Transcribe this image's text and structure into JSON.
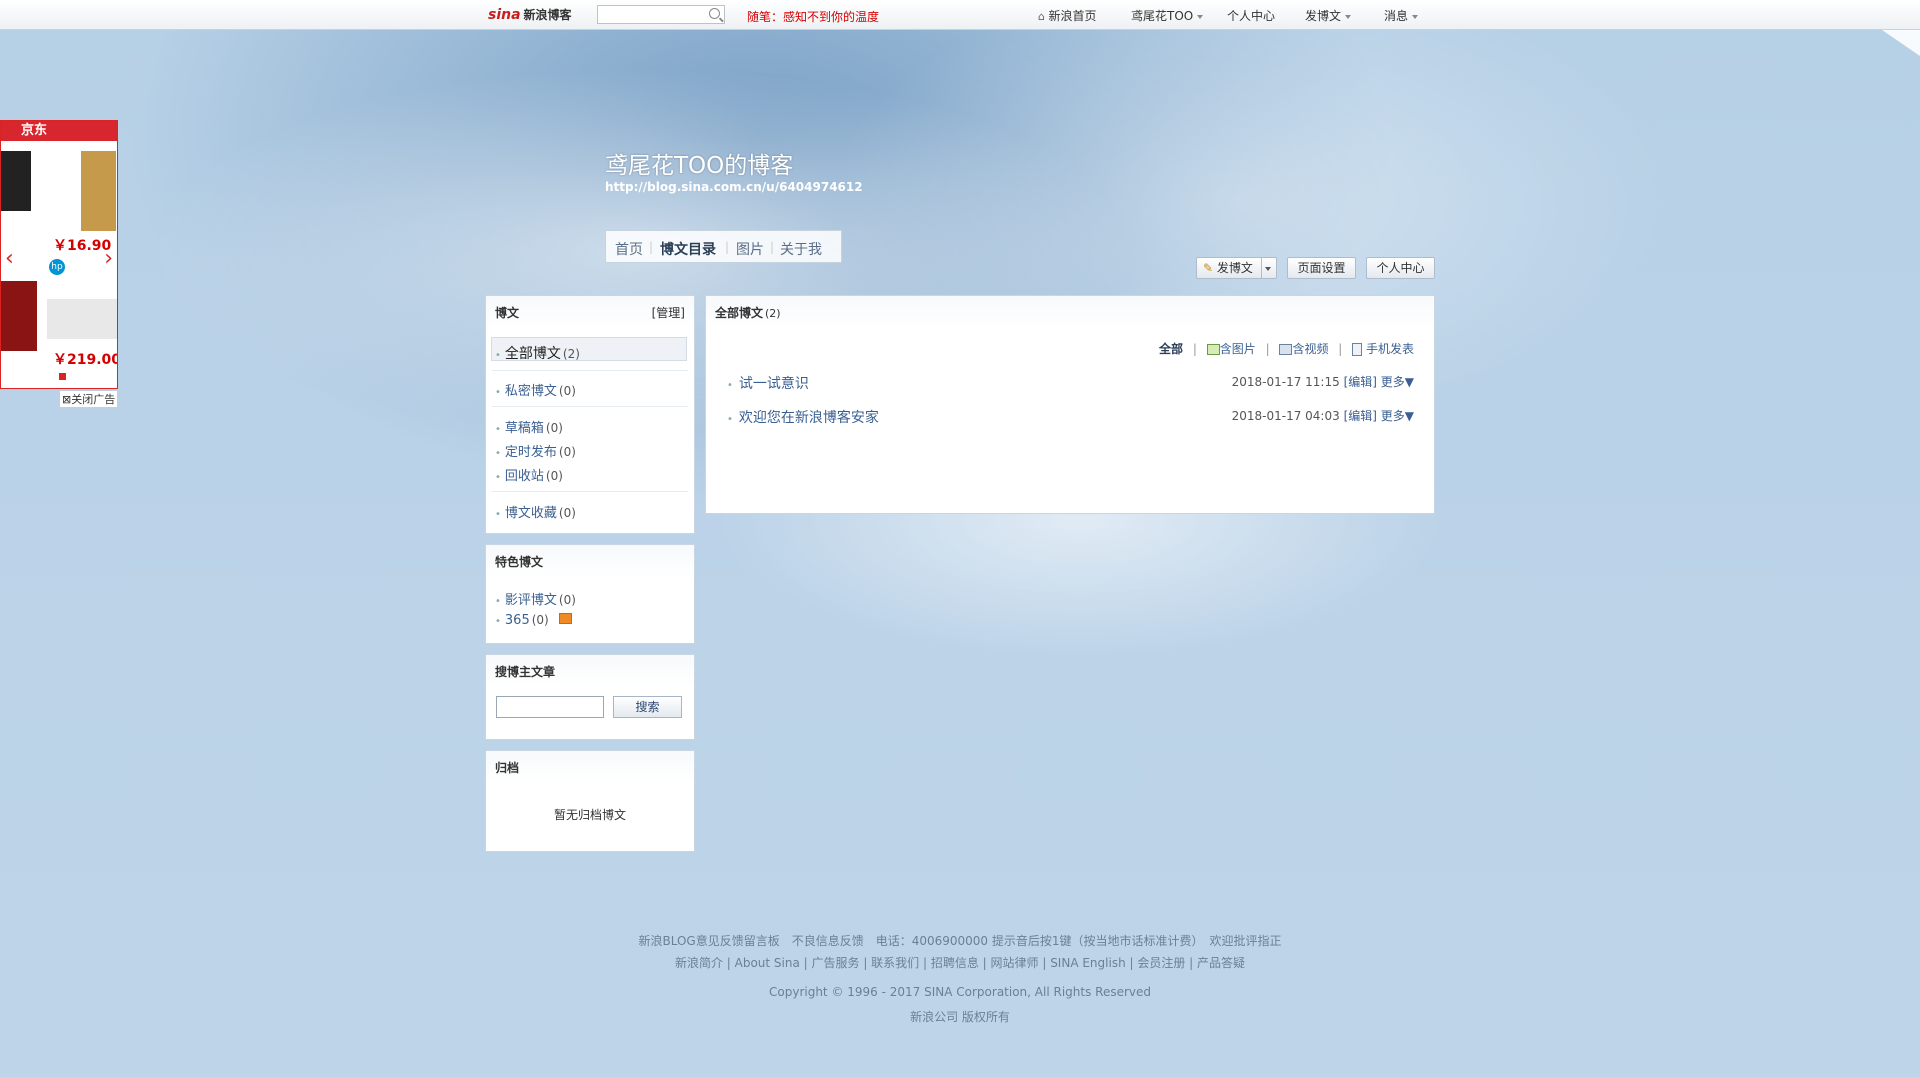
{
  "topbar": {
    "logo": "sina",
    "logo_sub": "新浪博客",
    "notice": "随笔：感知不到你的温度",
    "nav": [
      "新浪首页",
      "鸢尾花TOO",
      "个人中心",
      "发博文",
      "消息"
    ]
  },
  "ad": {
    "brand": "京东",
    "price1": "￥16.90",
    "price2": "￥219.00",
    "close": "关闭广告"
  },
  "blog": {
    "title": "鸢尾花TOO的博客",
    "url": "http://blog.sina.com.cn/u/6404974612",
    "tabs": [
      "首页",
      "博文目录",
      "图片",
      "关于我"
    ],
    "active_tab": "博文目录"
  },
  "buttons": {
    "write": "发博文",
    "page_settings": "页面设置",
    "personal": "个人中心"
  },
  "sidebar": {
    "blog_panel": {
      "title": "博文",
      "manage": "[管理]",
      "items": [
        {
          "label": "全部博文",
          "count": "(2)"
        },
        {
          "label": "私密博文",
          "count": "(0)"
        },
        {
          "label": "草稿箱",
          "count": "(0)"
        },
        {
          "label": "定时发布",
          "count": "(0)"
        },
        {
          "label": "回收站",
          "count": "(0)"
        },
        {
          "label": "博文收藏",
          "count": "(0)"
        }
      ]
    },
    "featured": {
      "title": "特色博文",
      "items": [
        {
          "label": "影评博文",
          "count": "(0)"
        },
        {
          "label": "365",
          "count": "(0)"
        }
      ]
    },
    "search": {
      "title": "搜博主文章",
      "button": "搜索"
    },
    "archive": {
      "title": "归档",
      "empty": "暂无归档博文"
    }
  },
  "main": {
    "title": "全部博文",
    "count": "(2)",
    "filters": [
      "全部",
      "含图片",
      "含视频",
      "手机发表"
    ],
    "posts": [
      {
        "title": "试一试意识",
        "date": "2018-01-17 11:15",
        "edit": "[编辑]",
        "more": "更多▼"
      },
      {
        "title": "欢迎您在新浪博客安家",
        "date": "2018-01-17 04:03",
        "edit": "[编辑]",
        "more": "更多▼"
      }
    ]
  },
  "footer": {
    "line1": "新浪BLOG意见反馈留言板　不良信息反馈　电话：4006900000 提示音后按1键（按当地市话标准计费）　欢迎批评指正",
    "line2": "新浪简介 | About Sina | 广告服务 | 联系我们 | 招聘信息 | 网站律师 | SINA English | 会员注册 | 产品答疑",
    "line3": "Copyright © 1996 - 2017 SINA Corporation, All Rights Reserved",
    "line4": "新浪公司 版权所有"
  }
}
